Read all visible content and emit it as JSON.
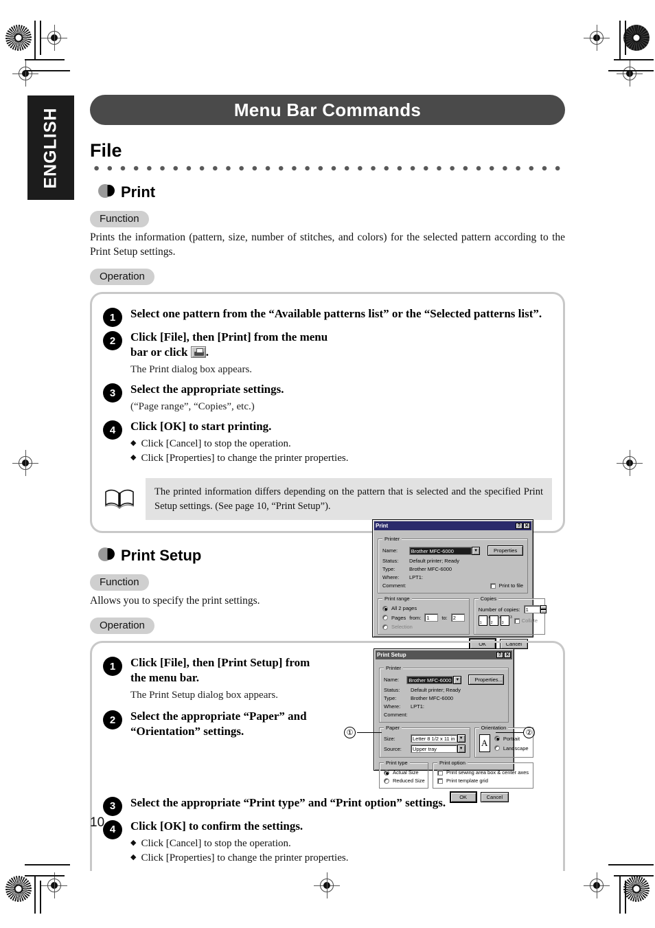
{
  "page": {
    "number": "10",
    "language_tab": "ENGLISH",
    "chapter_banner": "Menu Bar Commands",
    "section_title": "File"
  },
  "commands": [
    {
      "name": "Print",
      "function_pill": "Function",
      "function_text": "Prints the information (pattern, size, number of stitches, and colors) for the selected pattern according to the Print Setup settings.",
      "operation_pill": "Operation",
      "steps": [
        {
          "num": "1",
          "title": "Select one pattern from the “Available patterns list” or the “Selected patterns list”."
        },
        {
          "num": "2",
          "title_a": "Click [File], then [Print] from the menu",
          "title_b": "bar or click",
          "title_c": ".",
          "sub": "The Print dialog box appears."
        },
        {
          "num": "3",
          "title": "Select the appropriate settings.",
          "sub": "(“Page range”, “Copies”, etc.)"
        },
        {
          "num": "4",
          "title": "Click [OK] to start printing.",
          "diamonds": [
            "Click [Cancel] to stop the operation.",
            "Click [Properties] to change the printer properties."
          ]
        }
      ],
      "note": "The printed information differs depending on the pattern that is selected and the specified Print Setup settings. (See page 10, “Print Setup”)."
    },
    {
      "name": "Print Setup",
      "function_pill": "Function",
      "function_text": "Allows you to specify the print settings.",
      "operation_pill": "Operation",
      "steps": [
        {
          "num": "1",
          "title_a": "Click [File], then [Print Setup] from",
          "title_b": "the menu bar.",
          "sub": "The Print Setup dialog box appears."
        },
        {
          "num": "2",
          "title_a": "Select the appropriate “Paper” and",
          "title_b": "“Orientation” settings."
        },
        {
          "num": "3",
          "title": "Select the appropriate “Print type” and “Print option” settings."
        },
        {
          "num": "4",
          "title": "Click [OK] to confirm the settings.",
          "diamonds": [
            "Click [Cancel] to stop the operation.",
            "Click [Properties] to change the printer properties."
          ]
        }
      ]
    }
  ],
  "print_dialog": {
    "title": "Print",
    "help_btn": "?",
    "close_btn": "✕",
    "printer_group": "Printer",
    "name_label": "Name:",
    "name_value": "Brother MFC-6000",
    "properties_btn": "Properties",
    "status_label": "Status:",
    "status_value": "Default printer; Ready",
    "type_label": "Type:",
    "type_value": "Brother MFC-6000",
    "where_label": "Where:",
    "where_value": "LPT1:",
    "comment_label": "Comment:",
    "print_to_file": "Print to file",
    "range_group": "Print range",
    "range_all": "All 2 pages",
    "range_pages": "Pages",
    "from_label": "from:",
    "from_value": "1",
    "to_label": "to:",
    "to_value": "2",
    "range_selection": "Selection",
    "copies_group": "Copies",
    "copies_label": "Number of copies:",
    "copies_value": "1",
    "collate": "Collate",
    "ok_btn": "OK",
    "cancel_btn": "Cancel"
  },
  "print_setup_dialog": {
    "title": "Print Setup",
    "help_btn": "?",
    "close_btn": "✕",
    "printer_group": "Printer",
    "name_label": "Name:",
    "name_value": "Brother MFC-6000",
    "properties_btn": "Properties...",
    "status_label": "Status:",
    "status_value": "Default printer; Ready",
    "type_label": "Type:",
    "type_value": "Brother MFC-6000",
    "where_label": "Where:",
    "where_value": "LPT1:",
    "comment_label": "Comment:",
    "paper_group": "Paper",
    "size_label": "Size:",
    "size_value": "Letter 8 1/2 x 11 in",
    "source_label": "Source:",
    "source_value": "Upper tray",
    "orientation_group": "Orientation",
    "orientation_glyph": "A",
    "portrait": "Portrait",
    "landscape": "Landscape",
    "printtype_group": "Print type",
    "actual_size": "Actual Size",
    "reduced_size": "Reduced Size",
    "printoption_group": "Print option",
    "opt_sewing": "Print sewing area box & center axes",
    "opt_grid": "Print template grid",
    "ok_btn": "OK",
    "cancel_btn": "Cancel"
  },
  "callouts": {
    "one": "①",
    "two": "②"
  }
}
